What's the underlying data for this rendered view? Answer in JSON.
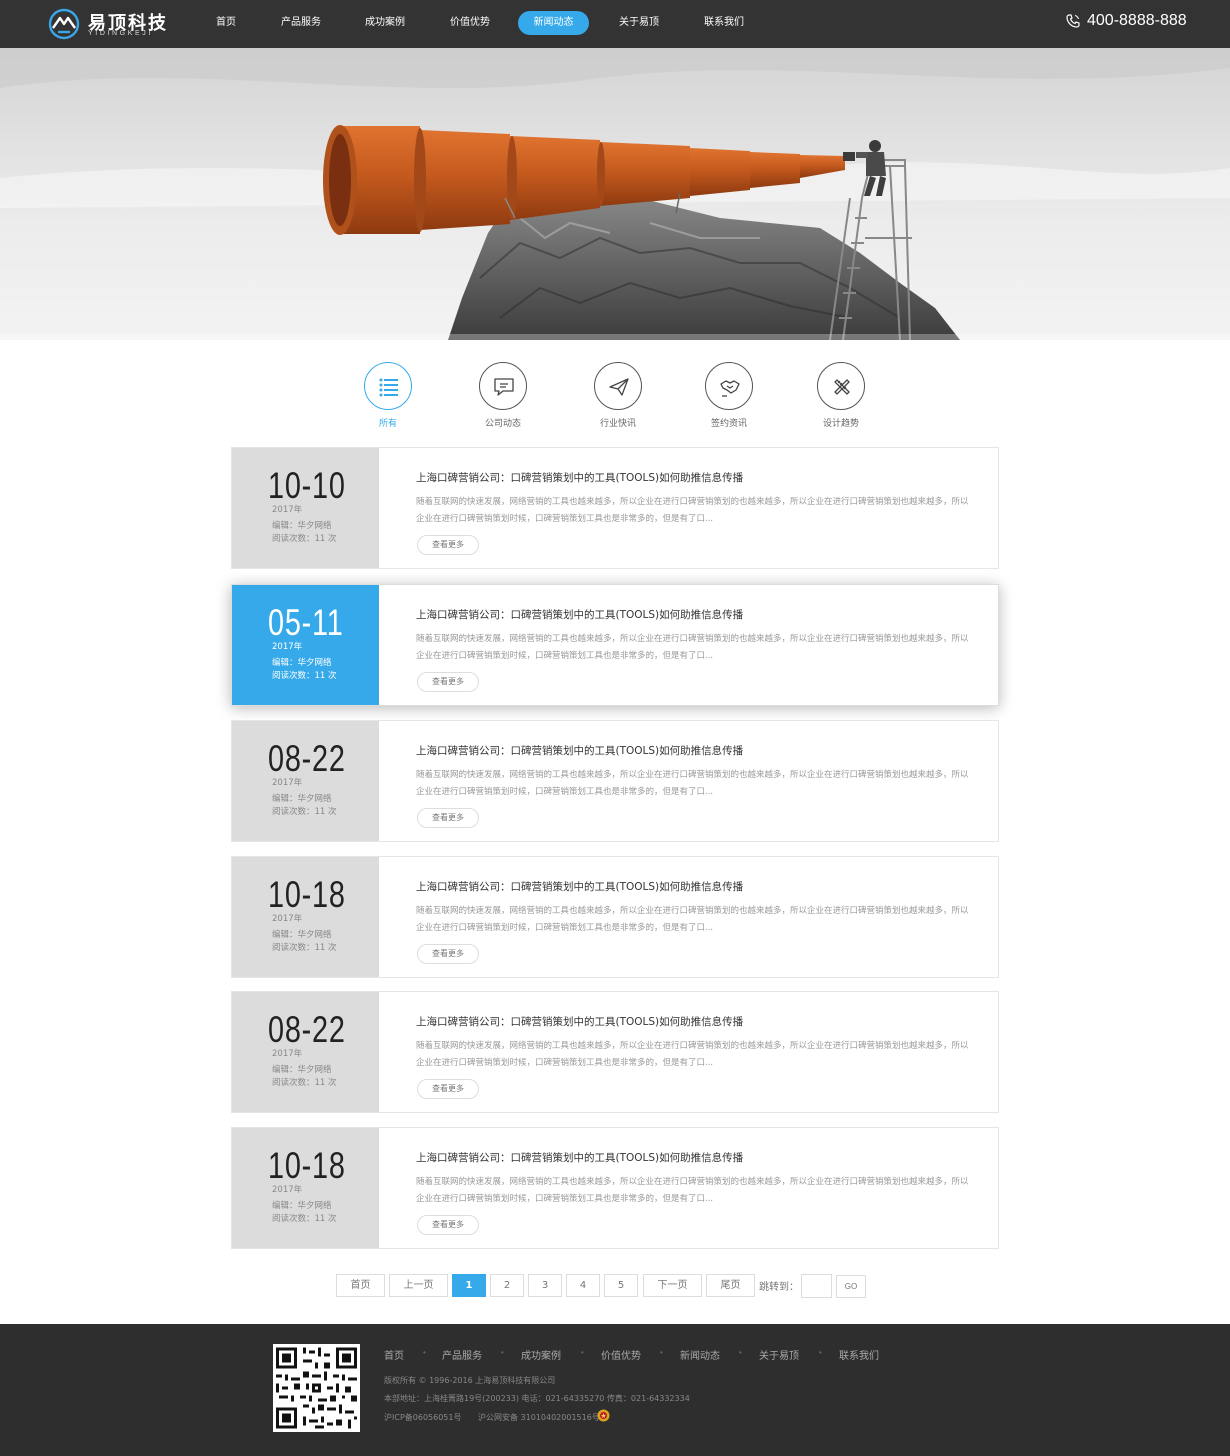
{
  "header": {
    "logo_cn": "易顶科技",
    "logo_en": "YIDINGKEJI",
    "nav": [
      {
        "label": "首页",
        "active": false
      },
      {
        "label": "产品服务",
        "active": false
      },
      {
        "label": "成功案例",
        "active": false
      },
      {
        "label": "价值优势",
        "active": false
      },
      {
        "label": "新闻动态",
        "active": true
      },
      {
        "label": "关于易顶",
        "active": false
      },
      {
        "label": "联系我们",
        "active": false
      }
    ],
    "phone": "400-8888-888"
  },
  "categories": [
    {
      "label": "所有",
      "icon": "list-icon",
      "active": true
    },
    {
      "label": "公司动态",
      "icon": "chat-icon",
      "active": false
    },
    {
      "label": "行业快讯",
      "icon": "paper-plane-icon",
      "active": false
    },
    {
      "label": "签约资讯",
      "icon": "handshake-icon",
      "active": false
    },
    {
      "label": "设计趋势",
      "icon": "design-tools-icon",
      "active": false
    }
  ],
  "news": [
    {
      "date": "10-10",
      "year": "2017年",
      "editor": "编辑：华夕网络",
      "reads": "阅读次数：11 次",
      "title": "上海口碑营销公司：口碑营销策划中的工具(TOOLS)如何助推信息传播",
      "summary": "随着互联网的快速发展，网络营销的工具也越来越多，所以企业在进行口碑营销策划的也越来越多，所以企业在进行口碑营销策划也越来越多，所以企业在进行口碑营销策划时候，口碑营销策划工具也是非常多的，但是有了口...",
      "more": "查看更多",
      "highlight": false
    },
    {
      "date": "05-11",
      "year": "2017年",
      "editor": "编辑：华夕网络",
      "reads": "阅读次数：11 次",
      "title": "上海口碑营销公司：口碑营销策划中的工具(TOOLS)如何助推信息传播",
      "summary": "随着互联网的快速发展，网络营销的工具也越来越多，所以企业在进行口碑营销策划的也越来越多，所以企业在进行口碑营销策划也越来越多，所以企业在进行口碑营销策划时候，口碑营销策划工具也是非常多的，但是有了口...",
      "more": "查看更多",
      "highlight": true
    },
    {
      "date": "08-22",
      "year": "2017年",
      "editor": "编辑：华夕网络",
      "reads": "阅读次数：11 次",
      "title": "上海口碑营销公司：口碑营销策划中的工具(TOOLS)如何助推信息传播",
      "summary": "随着互联网的快速发展，网络营销的工具也越来越多，所以企业在进行口碑营销策划的也越来越多，所以企业在进行口碑营销策划也越来越多，所以企业在进行口碑营销策划时候，口碑营销策划工具也是非常多的，但是有了口...",
      "more": "查看更多",
      "highlight": false
    },
    {
      "date": "10-18",
      "year": "2017年",
      "editor": "编辑：华夕网络",
      "reads": "阅读次数：11 次",
      "title": "上海口碑营销公司：口碑营销策划中的工具(TOOLS)如何助推信息传播",
      "summary": "随着互联网的快速发展，网络营销的工具也越来越多，所以企业在进行口碑营销策划的也越来越多，所以企业在进行口碑营销策划也越来越多，所以企业在进行口碑营销策划时候，口碑营销策划工具也是非常多的，但是有了口...",
      "more": "查看更多",
      "highlight": false
    },
    {
      "date": "08-22",
      "year": "2017年",
      "editor": "编辑：华夕网络",
      "reads": "阅读次数：11 次",
      "title": "上海口碑营销公司：口碑营销策划中的工具(TOOLS)如何助推信息传播",
      "summary": "随着互联网的快速发展，网络营销的工具也越来越多，所以企业在进行口碑营销策划的也越来越多，所以企业在进行口碑营销策划也越来越多，所以企业在进行口碑营销策划时候，口碑营销策划工具也是非常多的，但是有了口...",
      "more": "查看更多",
      "highlight": false
    },
    {
      "date": "10-18",
      "year": "2017年",
      "editor": "编辑：华夕网络",
      "reads": "阅读次数：11 次",
      "title": "上海口碑营销公司：口碑营销策划中的工具(TOOLS)如何助推信息传播",
      "summary": "随着互联网的快速发展，网络营销的工具也越来越多，所以企业在进行口碑营销策划的也越来越多，所以企业在进行口碑营销策划也越来越多，所以企业在进行口碑营销策划时候，口碑营销策划工具也是非常多的，但是有了口...",
      "more": "查看更多",
      "highlight": false
    }
  ],
  "pagination": {
    "first": "首页",
    "prev": "上一页",
    "pages": [
      "1",
      "2",
      "3",
      "4",
      "5"
    ],
    "current": "1",
    "next": "下一页",
    "last": "尾页",
    "jump_label": "跳转到：",
    "jump_value": "",
    "go": "GO"
  },
  "footer": {
    "nav": [
      "首页",
      "产品服务",
      "成功案例",
      "价值优势",
      "新闻动态",
      "关于易顶",
      "联系我们"
    ],
    "copyright": "版权所有 © 1996-2016  上海易顶科技有限公司",
    "address": "本部地址：上海桂箐路19号(200233)   电话：021-64335270   传真：021-64332334",
    "icp": "沪ICP备06056051号",
    "police": "沪公网安备 31010402001516号"
  },
  "colors": {
    "accent": "#35a9ea",
    "header_bg": "#333333",
    "footer_bg": "#2e2e2e",
    "date_box_bg": "#dcdcdc"
  }
}
